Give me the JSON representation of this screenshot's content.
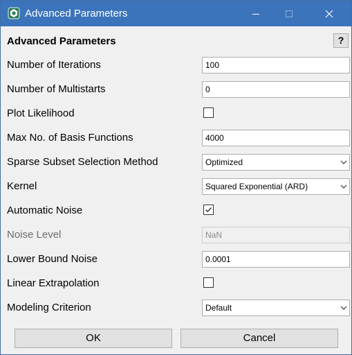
{
  "window": {
    "title": "Advanced Parameters"
  },
  "help": {
    "label": "?"
  },
  "heading": "Advanced Parameters",
  "rows": [
    {
      "label": "Number of Iterations",
      "type": "text",
      "value": "100"
    },
    {
      "label": "Number of Multistarts",
      "type": "text",
      "value": "0"
    },
    {
      "label": "Plot Likelihood",
      "type": "checkbox",
      "checked": false
    },
    {
      "label": "Max No. of Basis Functions",
      "type": "text",
      "value": "4000"
    },
    {
      "label": "Sparse Subset Selection Method",
      "type": "select",
      "value": "Optimized"
    },
    {
      "label": "Kernel",
      "type": "select",
      "value": "Squared Exponential (ARD)"
    },
    {
      "label": "Automatic Noise",
      "type": "checkbox",
      "checked": true
    },
    {
      "label": "Noise Level",
      "type": "text",
      "value": "NaN",
      "disabled": true
    },
    {
      "label": "Lower Bound Noise",
      "type": "text",
      "value": "0.0001"
    },
    {
      "label": "Linear Extrapolation",
      "type": "checkbox",
      "checked": false
    },
    {
      "label": "Modeling Criterion",
      "type": "select",
      "value": "Default"
    }
  ],
  "buttons": {
    "ok": "OK",
    "cancel": "Cancel"
  },
  "colors": {
    "titlebar": "#3b74bb",
    "background": "#f0f0f0",
    "button": "#e1e1e1"
  }
}
